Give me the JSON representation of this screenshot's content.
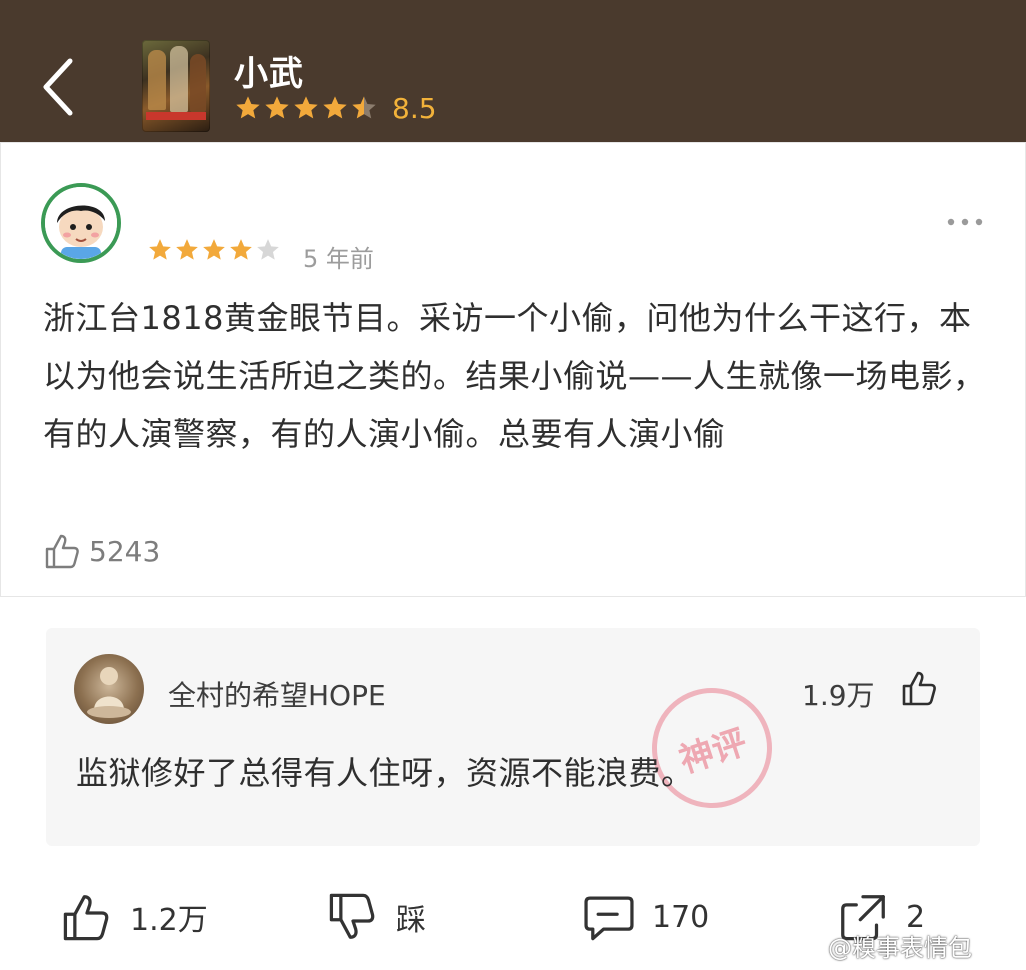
{
  "header": {
    "movie_title": "小武",
    "rating": "8.5",
    "rating_stars": 4.5,
    "back_icon": "chevron-left-icon"
  },
  "review": {
    "stars": 4,
    "time": "5 年前",
    "text": "浙江台1818黄金眼节目。采访一个小偷，问他为什么干这行，本以为他会说生活所迫之类的。结果小偷说——人生就像一场电影，有的人演警察，有的人演小偷。总要有人演小偷",
    "likes": "5243",
    "more_icon": "more-dots-icon"
  },
  "reply": {
    "user": "全村的希望HOPE",
    "likes": "1.9万",
    "text": "监狱修好了总得有人住呀，资源不能浪费。",
    "stamp": "神评"
  },
  "actions": {
    "like": "1.2万",
    "dislike": "踩",
    "comment": "170",
    "share": "2"
  },
  "watermark": "@糗事表情包",
  "colors": {
    "header_bg": "#4a3a2d",
    "star": "#f2a93b",
    "star_empty": "#d7d7d7",
    "accent_green": "#3b9a55"
  }
}
